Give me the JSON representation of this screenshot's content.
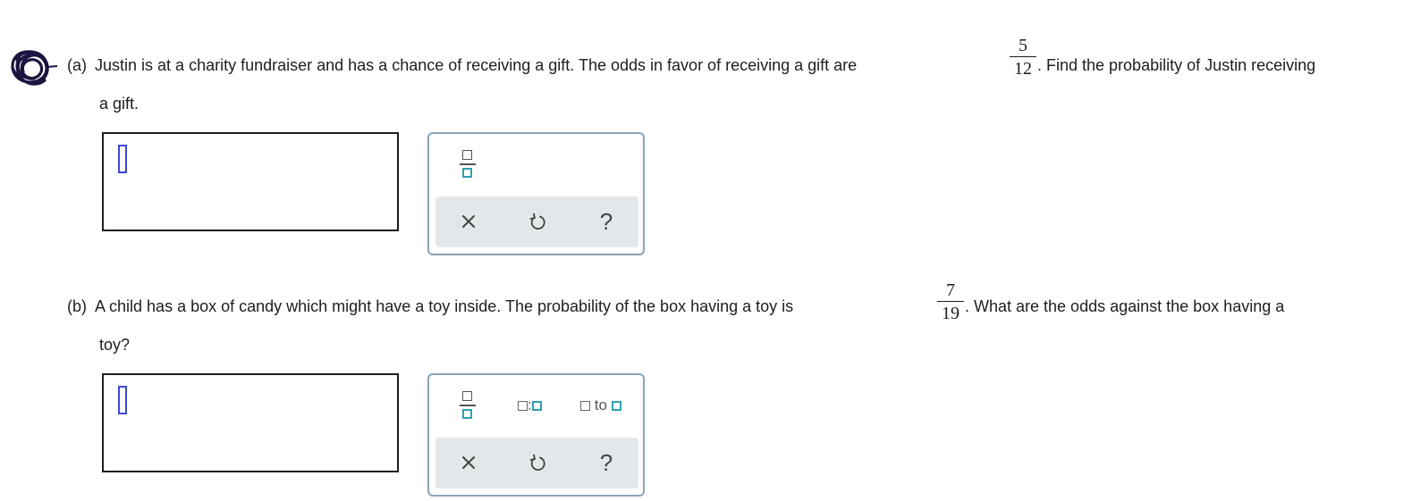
{
  "part_a": {
    "label": "(a)",
    "text_before": "Justin is at a charity fundraiser and has a chance of receiving a gift. The odds in favor of receiving a gift are",
    "fraction": {
      "numerator": "5",
      "denominator": "12"
    },
    "text_after": ". Find the probability of Justin receiving",
    "text_line2": "a gift.",
    "answer_value": "",
    "palette": {
      "tools": [
        "fraction-icon"
      ],
      "actions": [
        "clear-icon",
        "undo-icon",
        "help-icon"
      ],
      "help_glyph": "?"
    }
  },
  "part_b": {
    "label": "(b)",
    "text_before": "A child has a box of candy which might have a toy inside. The probability of the box having a toy is",
    "fraction": {
      "numerator": "7",
      "denominator": "19"
    },
    "text_after": ". What are the odds against the box having a",
    "text_line2": "toy?",
    "answer_value": "",
    "palette": {
      "tools": [
        "fraction-icon",
        "ratio-icon",
        "to-icon"
      ],
      "ratio_separator": ":",
      "to_label": "to",
      "actions": [
        "clear-icon",
        "undo-icon",
        "help-icon"
      ],
      "help_glyph": "?"
    }
  },
  "colors": {
    "text": "#1e1e1e",
    "cursor": "#3d46d8",
    "palette_border": "#87a5b6",
    "action_bar": "#e2e8ea",
    "teal_icon": "#2f9fb0"
  }
}
